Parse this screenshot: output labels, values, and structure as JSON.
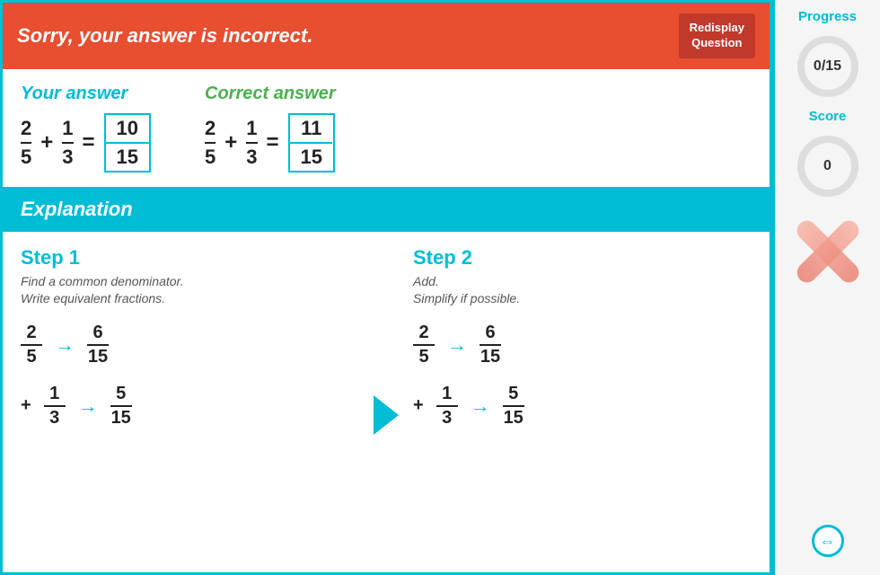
{
  "banner": {
    "text": "Sorry, your answer is incorrect.",
    "redisplay_label": "Redisplay\nQuestion"
  },
  "your_answer": {
    "label": "Your answer",
    "num1": {
      "n": "2",
      "d": "5"
    },
    "num2": {
      "n": "1",
      "d": "3"
    },
    "result_num": "10",
    "result_den": "15"
  },
  "correct_answer": {
    "label": "Correct answer",
    "num1": {
      "n": "2",
      "d": "5"
    },
    "num2": {
      "n": "1",
      "d": "3"
    },
    "result_num": "11",
    "result_den": "15"
  },
  "explanation": {
    "header": "Explanation",
    "step1": {
      "title": "Step 1",
      "desc": "Find a common denominator.\nWrite equivalent fractions.",
      "row1_from": {
        "n": "2",
        "d": "5"
      },
      "row1_to": {
        "n": "6",
        "d": "15"
      },
      "row2_from": {
        "n": "1",
        "d": "3"
      },
      "row2_to": {
        "n": "5",
        "d": "15"
      }
    },
    "step2": {
      "title": "Step 2",
      "desc": "Add.\nSimplify if possible.",
      "row1_from": {
        "n": "2",
        "d": "5"
      },
      "row1_to": {
        "n": "6",
        "d": "15"
      },
      "row2_from": {
        "n": "1",
        "d": "3"
      },
      "row2_to": {
        "n": "5",
        "d": "15"
      }
    }
  },
  "sidebar": {
    "progress_label": "Progress",
    "progress_value": "0/15",
    "score_label": "Score",
    "score_value": "0"
  },
  "colors": {
    "teal": "#00bcd4",
    "red": "#e84e30",
    "green": "#4caf50"
  }
}
